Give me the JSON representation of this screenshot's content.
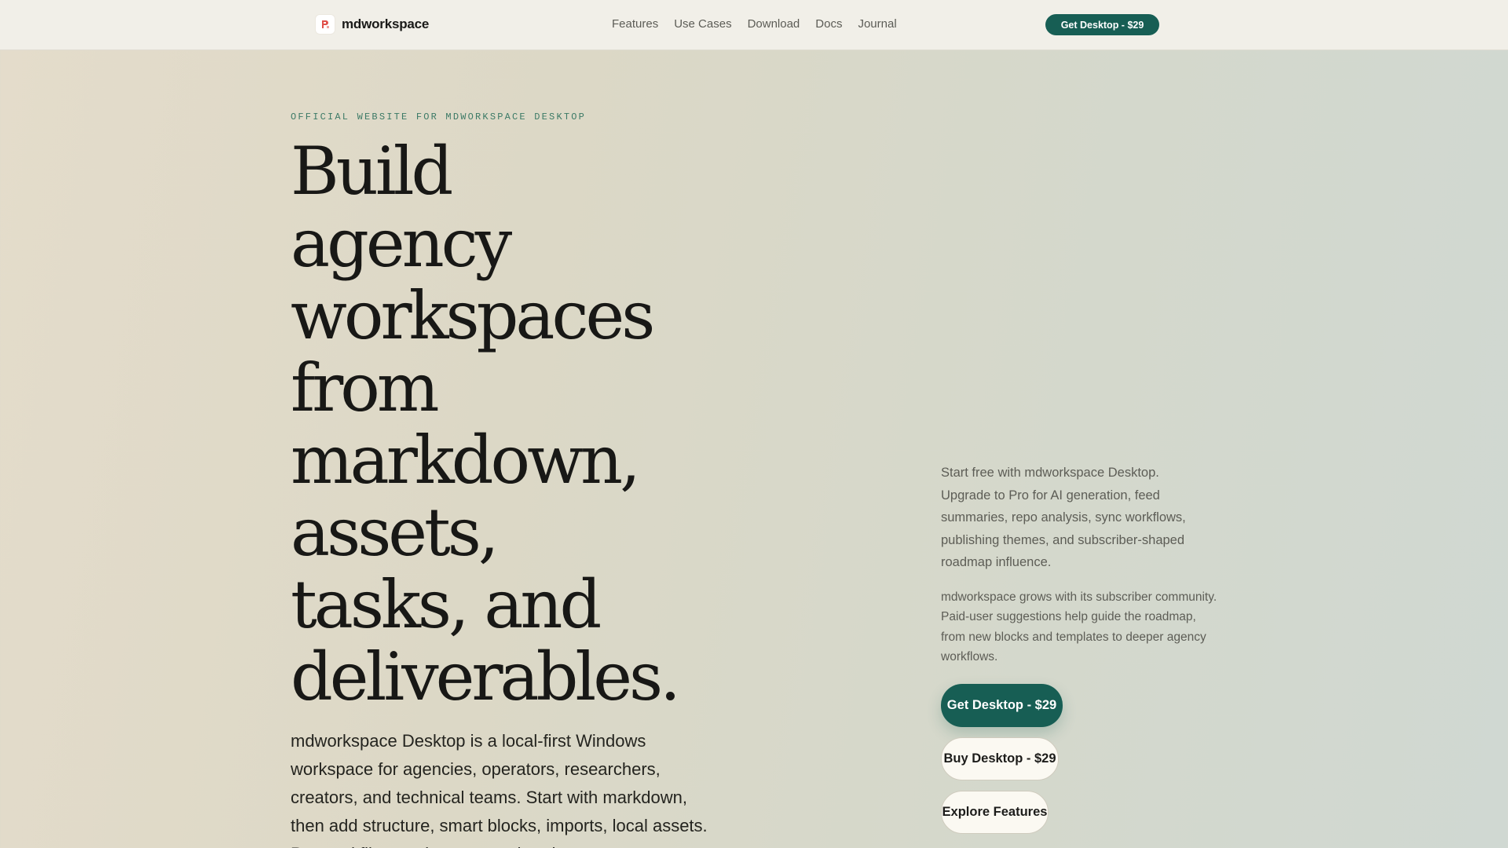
{
  "brand": {
    "name": "mdworkspace",
    "logo_icon": "mdworkspace-logo-icon"
  },
  "nav": {
    "items": [
      "Features",
      "Use Cases",
      "Download",
      "Docs",
      "Journal"
    ]
  },
  "header_cta": "Get Desktop - $29",
  "hero": {
    "eyebrow": "OFFICIAL WEBSITE FOR MDWORKSPACE DESKTOP",
    "headline_lines": [
      "Build",
      "agency",
      "workspaces",
      "from",
      "markdown,",
      "assets,",
      "tasks, and",
      "deliverables."
    ],
    "lead": "mdworkspace Desktop is a local-first Windows workspace for agencies, operators, researchers, creators, and technical teams. Start with markdown, then add structure, smart blocks, imports, local assets. Proceed files, and export rendered output."
  },
  "side": {
    "paragraph_1": "Start free with mdworkspace Desktop. Upgrade to Pro for AI generation, feed summaries, repo analysis, sync workflows, publishing themes, and subscriber-shaped roadmap influence.",
    "paragraph_2": "mdworkspace grows with its subscriber community. Paid-user suggestions help guide the roadmap, from new blocks and templates to deeper agency workflows.",
    "buttons": {
      "get_desktop": "Get Desktop - $29",
      "buy_desktop": "Buy Desktop - $29",
      "explore_features": "Explore Features"
    }
  },
  "colors": {
    "accent": "#175e54",
    "logo_red": "#e0504a",
    "topbar_bg": "#f1efe8",
    "eyebrow": "#3c7a66"
  }
}
